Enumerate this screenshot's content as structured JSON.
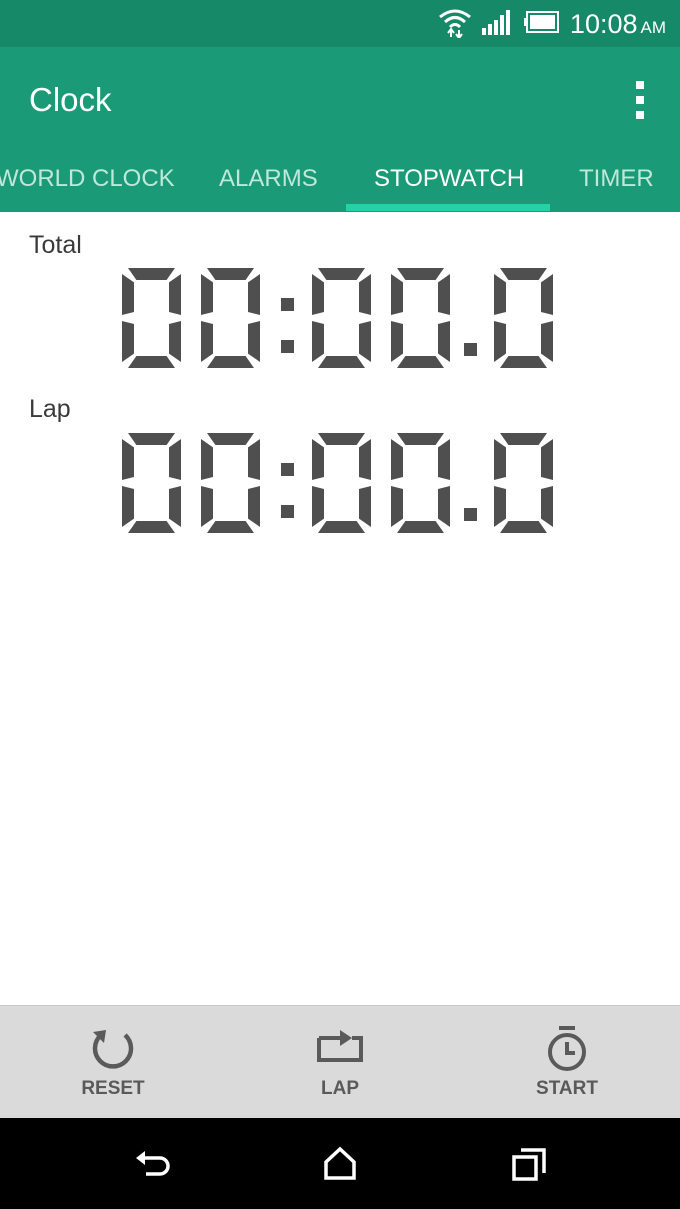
{
  "status_bar": {
    "time": "10:08",
    "ampm": "AM",
    "icons": [
      "wifi-icon",
      "signal-icon",
      "battery-icon"
    ]
  },
  "app_bar": {
    "title": "Clock",
    "menu_icon": "overflow-menu-icon"
  },
  "tabs": [
    {
      "label": "WORLD CLOCK",
      "active": false
    },
    {
      "label": "ALARMS",
      "active": false
    },
    {
      "label": "STOPWATCH",
      "active": true
    },
    {
      "label": "TIMER",
      "active": false
    }
  ],
  "stopwatch": {
    "total_label": "Total",
    "total_time": "00:00.0",
    "lap_label": "Lap",
    "lap_time": "00:00.0"
  },
  "actions": [
    {
      "label": "RESET",
      "icon": "reset-icon"
    },
    {
      "label": "LAP",
      "icon": "lap-icon"
    },
    {
      "label": "START",
      "icon": "stopwatch-icon"
    }
  ],
  "nav_bar": {
    "icons": [
      "back-icon",
      "home-icon",
      "recents-icon"
    ]
  },
  "colors": {
    "status_bar": "#168a68",
    "app_bar": "#1a9a77",
    "tab_indicator": "#22d3a7",
    "lcd_digit": "#4f4f4f",
    "bottom_bar": "#dadada"
  }
}
